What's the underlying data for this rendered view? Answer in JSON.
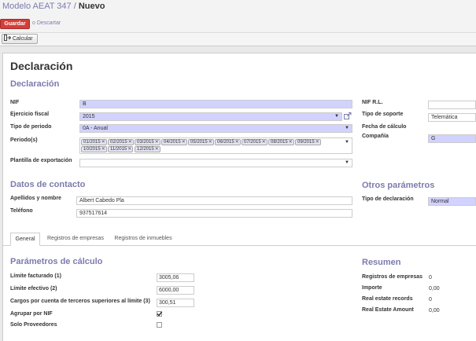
{
  "breadcrumb": {
    "parent": "Modelo AEAT 347",
    "separator": "/",
    "current": "Nuevo"
  },
  "actions": {
    "save": "Guardar",
    "or": "o",
    "discard": "Descartar",
    "calculate": "Calcular"
  },
  "form": {
    "title": "Declaración",
    "section_declaracion": "Declaración",
    "nif_label": "NIF",
    "nif_value": "B",
    "ejercicio_label": "Ejercicio fiscal",
    "ejercicio_value": "2015",
    "tipo_periodo_label": "Tipo de periodo",
    "tipo_periodo_value": "0A - Anual",
    "periodos_label": "Periodo(s)",
    "periodos": [
      "01/2015",
      "02/2015",
      "03/2015",
      "04/2015",
      "05/2015",
      "06/2015",
      "07/2015",
      "08/2015",
      "09/2015",
      "10/2015",
      "11/2015",
      "12/2015"
    ],
    "plantilla_label": "Plantilla de exportación",
    "plantilla_value": "",
    "nif_rl_label": "NIF R.L.",
    "nif_rl_value": "",
    "tipo_soporte_label": "Tipo de soporte",
    "tipo_soporte_value": "Telemática",
    "fecha_calculo_label": "Fecha de cálculo",
    "compania_label": "Compañía",
    "compania_value": "G",
    "section_contacto": "Datos de contacto",
    "apellidos_label": "Apellidos y nombre",
    "apellidos_value": "Albert Cabedo Pla",
    "telefono_label": "Teléfono",
    "telefono_value": "937517614",
    "section_otros": "Otros parámetros",
    "tipo_declaracion_label": "Tipo de declaración",
    "tipo_declaracion_value": "Normal"
  },
  "tabs": [
    "General",
    "Registros de empresas",
    "Registros de inmuebles"
  ],
  "calc": {
    "title": "Parámetros de cálculo",
    "limite_facturado_label": "Límite facturado (1)",
    "limite_facturado_value": "3005,06",
    "limite_efectivo_label": "Límite efectivo (2)",
    "limite_efectivo_value": "6000,00",
    "cargos_label": "Cargos por cuenta de terceros superiores al límite (3)",
    "cargos_value": "300,51",
    "agrupar_label": "Agrupar por NIF",
    "agrupar_checked": true,
    "solo_label": "Solo Proveedores",
    "solo_checked": false
  },
  "resumen": {
    "title": "Resumen",
    "registros_label": "Registros de empresas",
    "registros_value": "0",
    "importe_label": "Importe",
    "importe_value": "0,00",
    "real_records_label": "Real estate records",
    "real_records_value": "0",
    "real_amount_label": "Real Estate Amount",
    "real_amount_value": "0,00"
  },
  "colors": {
    "accent": "#7c7bad",
    "save": "#d23f3a",
    "required": "#d2d2ff"
  }
}
